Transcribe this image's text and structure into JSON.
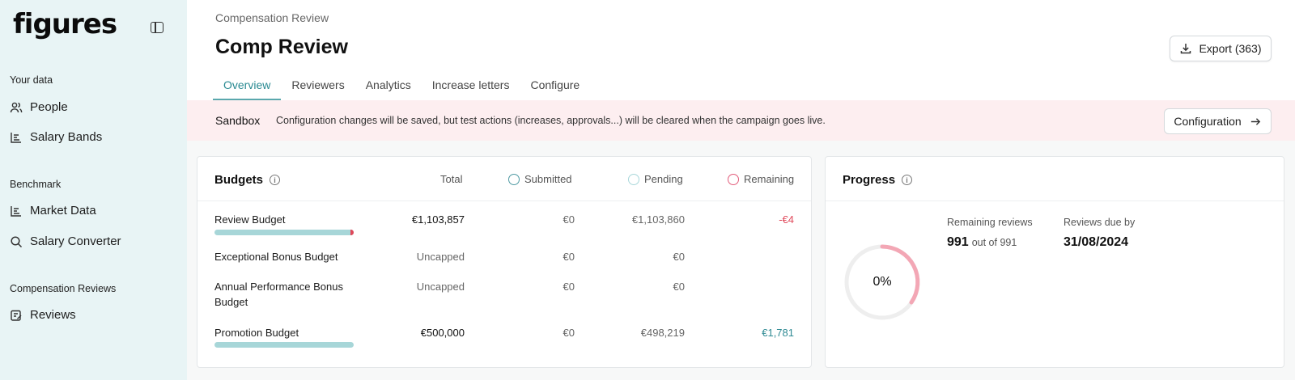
{
  "app": {
    "logo": "figures"
  },
  "sidebar": {
    "sections": [
      {
        "title": "Your data",
        "items": [
          {
            "label": "People",
            "icon": "people-icon"
          },
          {
            "label": "Salary Bands",
            "icon": "salary-bands-icon"
          }
        ]
      },
      {
        "title": "Benchmark",
        "items": [
          {
            "label": "Market Data",
            "icon": "market-data-icon"
          },
          {
            "label": "Salary Converter",
            "icon": "search-icon"
          }
        ]
      },
      {
        "title": "Compensation Reviews",
        "items": [
          {
            "label": "Reviews",
            "icon": "reviews-icon"
          }
        ]
      }
    ]
  },
  "header": {
    "breadcrumb": "Compensation Review",
    "title": "Comp Review",
    "export_label": "Export (363)",
    "tabs": [
      {
        "label": "Overview",
        "active": true
      },
      {
        "label": "Reviewers"
      },
      {
        "label": "Analytics"
      },
      {
        "label": "Increase letters"
      },
      {
        "label": "Configure"
      }
    ]
  },
  "sandbox": {
    "label": "Sandbox",
    "message": "Configuration changes will be saved, but test actions (increases, approvals...) will be cleared when the campaign goes live.",
    "button_label": "Configuration"
  },
  "budgets": {
    "title": "Budgets",
    "columns": {
      "total": "Total",
      "submitted": "Submitted",
      "pending": "Pending",
      "remaining": "Remaining"
    },
    "rows": [
      {
        "label": "Review Budget",
        "total": "€1,103,857",
        "submitted": "€0",
        "pending": "€1,103,860",
        "remaining": "-€4",
        "bar_fraction": 1.0
      },
      {
        "label": "Exceptional Bonus Budget",
        "total": "Uncapped",
        "submitted": "€0",
        "pending": "€0",
        "remaining": ""
      },
      {
        "label": "Annual Performance Bonus Budget",
        "total": "Uncapped",
        "submitted": "€0",
        "pending": "€0",
        "remaining": ""
      },
      {
        "label": "Promotion Budget",
        "total": "€500,000",
        "submitted": "€0",
        "pending": "€498,219",
        "remaining": "€1,781",
        "bar_fraction": 0.996
      }
    ]
  },
  "progress": {
    "title": "Progress",
    "percent_label": "0%",
    "remaining_label": "Remaining reviews",
    "remaining_value": "991",
    "remaining_sub": "out of 991",
    "due_label": "Reviews due by",
    "due_value": "31/08/2024"
  },
  "colors": {
    "accent": "#2a8a92",
    "submitted": "#4f9aa3",
    "pending": "#a9d7da",
    "remaining": "#e25b7a",
    "negative": "#e0485a",
    "positive": "#2f8a93"
  }
}
